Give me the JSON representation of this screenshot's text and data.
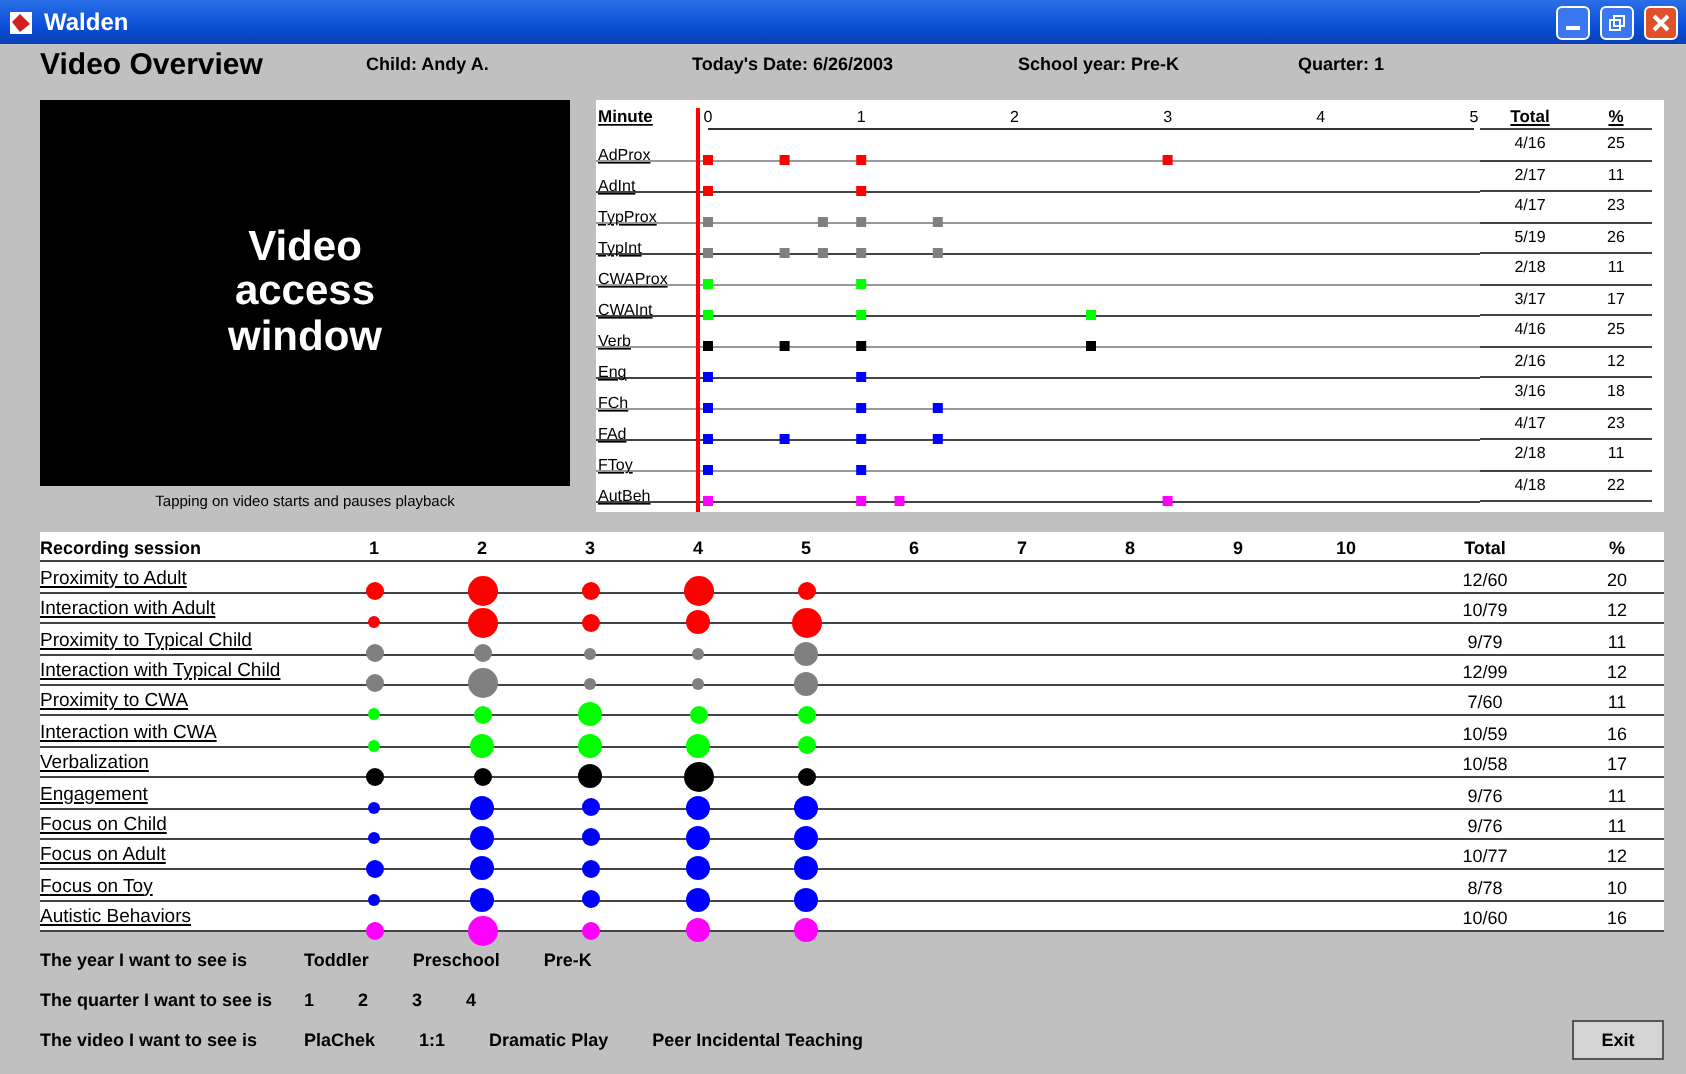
{
  "window": {
    "title": "Walden"
  },
  "header": {
    "title": "Video Overview",
    "child": "Child: Andy A.",
    "date": "Today's Date: 6/26/2003",
    "school_year": "School year: Pre-K",
    "quarter": "Quarter: 1"
  },
  "video": {
    "text": "Video access window",
    "caption": "Tapping on video starts and pauses playback"
  },
  "timeline": {
    "total_label": "Total",
    "percent_label": "%",
    "rows": [
      {
        "total": "4/16",
        "percent": "25"
      },
      {
        "total": "2/17",
        "percent": "11"
      },
      {
        "total": "4/17",
        "percent": "23"
      },
      {
        "total": "5/19",
        "percent": "26"
      },
      {
        "total": "2/18",
        "percent": "11"
      },
      {
        "total": "3/17",
        "percent": "17"
      },
      {
        "total": "4/16",
        "percent": "25"
      },
      {
        "total": "2/16",
        "percent": "12"
      },
      {
        "total": "3/16",
        "percent": "18"
      },
      {
        "total": "4/17",
        "percent": "23"
      },
      {
        "total": "2/18",
        "percent": "11"
      },
      {
        "total": "4/18",
        "percent": "22"
      }
    ],
    "chart_data": {
      "type": "scatter",
      "orientation": "horizontal",
      "xlabel": "Minute",
      "xlim": [
        0,
        5
      ],
      "xticks": [
        0,
        1,
        2,
        3,
        4,
        5
      ],
      "categories": [
        "AdProx",
        "AdInt",
        "TypProx",
        "TypInt",
        "CWAProx",
        "CWAInt",
        "Verb",
        "Eng",
        "FCh",
        "FAd",
        "FToy",
        "AutBeh"
      ],
      "series": [
        {
          "color": "#ff0000",
          "values": [
            0,
            null,
            null,
            null,
            null,
            null,
            null,
            null,
            null,
            null,
            null,
            null
          ]
        },
        {
          "color": "#ff0000",
          "values": [
            0.5,
            null,
            null,
            null,
            null,
            null,
            null,
            null,
            null,
            null,
            null,
            null
          ]
        },
        {
          "color": "#ff0000",
          "values": [
            1,
            null,
            null,
            null,
            null,
            null,
            null,
            null,
            null,
            null,
            null,
            null
          ]
        },
        {
          "color": "#ff0000",
          "values": [
            3,
            null,
            null,
            null,
            null,
            null,
            null,
            null,
            null,
            null,
            null,
            null
          ]
        },
        {
          "color": "#ff0000",
          "values": [
            null,
            0,
            null,
            null,
            null,
            null,
            null,
            null,
            null,
            null,
            null,
            null
          ]
        },
        {
          "color": "#ff0000",
          "values": [
            null,
            1,
            null,
            null,
            null,
            null,
            null,
            null,
            null,
            null,
            null,
            null
          ]
        },
        {
          "color": "#808080",
          "values": [
            null,
            null,
            0,
            null,
            null,
            null,
            null,
            null,
            null,
            null,
            null,
            null
          ]
        },
        {
          "color": "#808080",
          "values": [
            null,
            null,
            0.75,
            null,
            null,
            null,
            null,
            null,
            null,
            null,
            null,
            null
          ]
        },
        {
          "color": "#808080",
          "values": [
            null,
            null,
            1,
            null,
            null,
            null,
            null,
            null,
            null,
            null,
            null,
            null
          ]
        },
        {
          "color": "#808080",
          "values": [
            null,
            null,
            1.5,
            null,
            null,
            null,
            null,
            null,
            null,
            null,
            null,
            null
          ]
        },
        {
          "color": "#808080",
          "values": [
            null,
            null,
            null,
            0,
            null,
            null,
            null,
            null,
            null,
            null,
            null,
            null
          ]
        },
        {
          "color": "#808080",
          "values": [
            null,
            null,
            null,
            0.5,
            null,
            null,
            null,
            null,
            null,
            null,
            null,
            null
          ]
        },
        {
          "color": "#808080",
          "values": [
            null,
            null,
            null,
            0.75,
            null,
            null,
            null,
            null,
            null,
            null,
            null,
            null
          ]
        },
        {
          "color": "#808080",
          "values": [
            null,
            null,
            null,
            1,
            null,
            null,
            null,
            null,
            null,
            null,
            null,
            null
          ]
        },
        {
          "color": "#808080",
          "values": [
            null,
            null,
            null,
            1.5,
            null,
            null,
            null,
            null,
            null,
            null,
            null,
            null
          ]
        },
        {
          "color": "#00ff00",
          "values": [
            null,
            null,
            null,
            null,
            0,
            null,
            null,
            null,
            null,
            null,
            null,
            null
          ]
        },
        {
          "color": "#00ff00",
          "values": [
            null,
            null,
            null,
            null,
            1,
            null,
            null,
            null,
            null,
            null,
            null,
            null
          ]
        },
        {
          "color": "#00ff00",
          "values": [
            null,
            null,
            null,
            null,
            null,
            0,
            null,
            null,
            null,
            null,
            null,
            null
          ]
        },
        {
          "color": "#00ff00",
          "values": [
            null,
            null,
            null,
            null,
            null,
            1,
            null,
            null,
            null,
            null,
            null,
            null
          ]
        },
        {
          "color": "#00ff00",
          "values": [
            null,
            null,
            null,
            null,
            null,
            2.5,
            null,
            null,
            null,
            null,
            null,
            null
          ]
        },
        {
          "color": "#000000",
          "values": [
            null,
            null,
            null,
            null,
            null,
            null,
            0,
            null,
            null,
            null,
            null,
            null
          ]
        },
        {
          "color": "#000000",
          "values": [
            null,
            null,
            null,
            null,
            null,
            null,
            0.5,
            null,
            null,
            null,
            null,
            null
          ]
        },
        {
          "color": "#000000",
          "values": [
            null,
            null,
            null,
            null,
            null,
            null,
            1,
            null,
            null,
            null,
            null,
            null
          ]
        },
        {
          "color": "#000000",
          "values": [
            null,
            null,
            null,
            null,
            null,
            null,
            2.5,
            null,
            null,
            null,
            null,
            null
          ]
        },
        {
          "color": "#0000ff",
          "values": [
            null,
            null,
            null,
            null,
            null,
            null,
            null,
            0,
            null,
            null,
            null,
            null
          ]
        },
        {
          "color": "#0000ff",
          "values": [
            null,
            null,
            null,
            null,
            null,
            null,
            null,
            1,
            null,
            null,
            null,
            null
          ]
        },
        {
          "color": "#0000ff",
          "values": [
            null,
            null,
            null,
            null,
            null,
            null,
            null,
            null,
            0,
            null,
            null,
            null
          ]
        },
        {
          "color": "#0000ff",
          "values": [
            null,
            null,
            null,
            null,
            null,
            null,
            null,
            null,
            1,
            null,
            null,
            null
          ]
        },
        {
          "color": "#0000ff",
          "values": [
            null,
            null,
            null,
            null,
            null,
            null,
            null,
            null,
            1.5,
            null,
            null,
            null
          ]
        },
        {
          "color": "#0000ff",
          "values": [
            null,
            null,
            null,
            null,
            null,
            null,
            null,
            null,
            null,
            0,
            null,
            null
          ]
        },
        {
          "color": "#0000ff",
          "values": [
            null,
            null,
            null,
            null,
            null,
            null,
            null,
            null,
            null,
            0.5,
            null,
            null
          ]
        },
        {
          "color": "#0000ff",
          "values": [
            null,
            null,
            null,
            null,
            null,
            null,
            null,
            null,
            null,
            1,
            null,
            null
          ]
        },
        {
          "color": "#0000ff",
          "values": [
            null,
            null,
            null,
            null,
            null,
            null,
            null,
            null,
            null,
            1.5,
            null,
            null
          ]
        },
        {
          "color": "#0000ff",
          "values": [
            null,
            null,
            null,
            null,
            null,
            null,
            null,
            null,
            null,
            null,
            0,
            null
          ]
        },
        {
          "color": "#0000ff",
          "values": [
            null,
            null,
            null,
            null,
            null,
            null,
            null,
            null,
            null,
            null,
            1,
            null
          ]
        },
        {
          "color": "#ff00ff",
          "values": [
            null,
            null,
            null,
            null,
            null,
            null,
            null,
            null,
            null,
            null,
            null,
            0
          ]
        },
        {
          "color": "#ff00ff",
          "values": [
            null,
            null,
            null,
            null,
            null,
            null,
            null,
            null,
            null,
            null,
            null,
            1
          ]
        },
        {
          "color": "#ff00ff",
          "values": [
            null,
            null,
            null,
            null,
            null,
            null,
            null,
            null,
            null,
            null,
            null,
            1.25
          ]
        },
        {
          "color": "#ff00ff",
          "values": [
            null,
            null,
            null,
            null,
            null,
            null,
            null,
            null,
            null,
            null,
            null,
            3
          ]
        }
      ]
    }
  },
  "sessions": {
    "label": "Recording session",
    "columns": [
      "1",
      "2",
      "3",
      "4",
      "5",
      "6",
      "7",
      "8",
      "9",
      "10"
    ],
    "total_label": "Total",
    "percent_label": "%",
    "rows": [
      {
        "name": "Proximity to Adult",
        "color": "#ff0000",
        "dots": [
          {
            "kind": "medium"
          },
          {
            "kind": "huge"
          },
          {
            "kind": "medium"
          },
          {
            "kind": "huge"
          },
          {
            "kind": "medium"
          }
        ],
        "total": "12/60",
        "percent": "20"
      },
      {
        "name": "Interaction with Adult",
        "color": "#ff0000",
        "dots": [
          {
            "kind": "small"
          },
          {
            "kind": "huge"
          },
          {
            "kind": "medium"
          },
          {
            "kind": "large"
          },
          {
            "kind": "huge"
          }
        ],
        "total": "10/79",
        "percent": "12"
      },
      {
        "name": "Proximity to Typical Child",
        "color": "#808080",
        "dots": [
          {
            "kind": "medium"
          },
          {
            "kind": "medium"
          },
          {
            "kind": "small"
          },
          {
            "kind": "small"
          },
          {
            "kind": "large"
          }
        ],
        "total": "9/79",
        "percent": "11"
      },
      {
        "name": "Interaction with Typical Child",
        "color": "#808080",
        "dots": [
          {
            "kind": "medium"
          },
          {
            "kind": "huge"
          },
          {
            "kind": "small"
          },
          {
            "kind": "small"
          },
          {
            "kind": "large"
          }
        ],
        "total": "12/99",
        "percent": "12"
      },
      {
        "name": "Proximity to CWA",
        "color": "#00ff00",
        "dots": [
          {
            "kind": "small"
          },
          {
            "kind": "medium"
          },
          {
            "kind": "large"
          },
          {
            "kind": "medium"
          },
          {
            "kind": "medium"
          }
        ],
        "total": "7/60",
        "percent": "11"
      },
      {
        "name": "Interaction with CWA",
        "color": "#00ff00",
        "dots": [
          {
            "kind": "small"
          },
          {
            "kind": "large"
          },
          {
            "kind": "large"
          },
          {
            "kind": "large"
          },
          {
            "kind": "medium"
          }
        ],
        "total": "10/59",
        "percent": "16"
      },
      {
        "name": "Verbalization",
        "color": "#000000",
        "dots": [
          {
            "kind": "medium"
          },
          {
            "kind": "medium"
          },
          {
            "kind": "large"
          },
          {
            "kind": "huge"
          },
          {
            "kind": "medium"
          }
        ],
        "total": "10/58",
        "percent": "17"
      },
      {
        "name": "Engagement",
        "color": "#0000ff",
        "dots": [
          {
            "kind": "small"
          },
          {
            "kind": "large"
          },
          {
            "kind": "medium"
          },
          {
            "kind": "large"
          },
          {
            "kind": "large"
          }
        ],
        "total": "9/76",
        "percent": "11"
      },
      {
        "name": "Focus on Child",
        "color": "#0000ff",
        "dots": [
          {
            "kind": "small"
          },
          {
            "kind": "large"
          },
          {
            "kind": "medium"
          },
          {
            "kind": "large"
          },
          {
            "kind": "large"
          }
        ],
        "total": "9/76",
        "percent": "11"
      },
      {
        "name": "Focus on Adult",
        "color": "#0000ff",
        "dots": [
          {
            "kind": "medium"
          },
          {
            "kind": "large"
          },
          {
            "kind": "medium"
          },
          {
            "kind": "large"
          },
          {
            "kind": "large"
          }
        ],
        "total": "10/77",
        "percent": "12"
      },
      {
        "name": "Focus on Toy",
        "color": "#0000ff",
        "dots": [
          {
            "kind": "small"
          },
          {
            "kind": "large"
          },
          {
            "kind": "medium"
          },
          {
            "kind": "large"
          },
          {
            "kind": "large"
          }
        ],
        "total": "8/78",
        "percent": "10"
      },
      {
        "name": "Autistic Behaviors",
        "color": "#ff00ff",
        "dots": [
          {
            "kind": "medium"
          },
          {
            "kind": "huge"
          },
          {
            "kind": "medium"
          },
          {
            "kind": "large"
          },
          {
            "kind": "large"
          }
        ],
        "total": "10/60",
        "percent": "16"
      }
    ]
  },
  "choices": [
    {
      "label": "The year I want to see is",
      "options": [
        "Toddler",
        "Preschool",
        "Pre-K"
      ]
    },
    {
      "label": "The quarter I want to see is",
      "options": [
        "1",
        "2",
        "3",
        "4"
      ]
    },
    {
      "label": "The video I want to see is",
      "options": [
        "PlaChek",
        "1:1",
        "Dramatic Play",
        "Peer Incidental Teaching"
      ]
    }
  ],
  "buttons": [
    "Exit"
  ]
}
